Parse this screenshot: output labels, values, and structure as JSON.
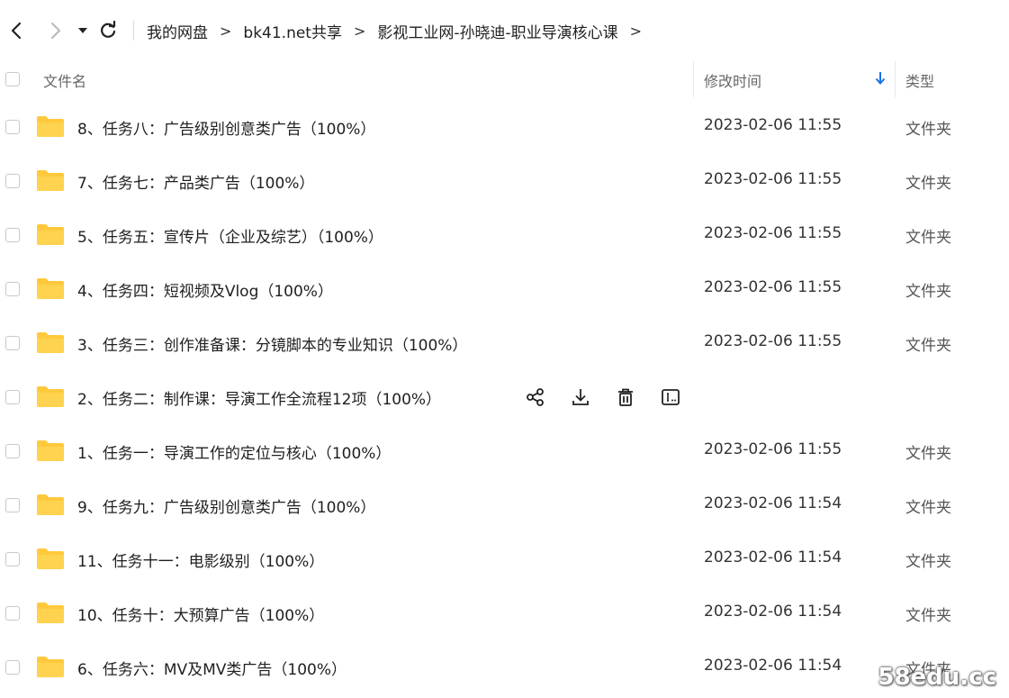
{
  "breadcrumb": [
    {
      "label": "我的网盘"
    },
    {
      "label": "bk41.net共享"
    },
    {
      "label": "影视工业网-孙晓迪-职业导演核心课"
    }
  ],
  "breadcrumb_trailing_sep": ">",
  "separator": ">",
  "columns": {
    "name": "文件名",
    "modified": "修改时间",
    "type": "类型"
  },
  "rows": [
    {
      "name": "8、任务八：广告级别创意类广告（100%）",
      "time": "2023-02-06 11:55",
      "type": "文件夹"
    },
    {
      "name": "7、任务七：产品类广告（100%）",
      "time": "2023-02-06 11:55",
      "type": "文件夹"
    },
    {
      "name": "5、任务五：宣传片（企业及综艺）（100%）",
      "time": "2023-02-06 11:55",
      "type": "文件夹"
    },
    {
      "name": "4、任务四：短视频及Vlog（100%）",
      "time": "2023-02-06 11:55",
      "type": "文件夹"
    },
    {
      "name": "3、任务三：创作准备课：分镜脚本的专业知识（100%）",
      "time": "2023-02-06 11:55",
      "type": "文件夹"
    },
    {
      "name": "2、任务二：制作课：导演工作全流程12项（100%）",
      "time": "",
      "type": "",
      "hovered": true
    },
    {
      "name": "1、任务一：导演工作的定位与核心（100%）",
      "time": "2023-02-06 11:55",
      "type": "文件夹"
    },
    {
      "name": "9、任务九：广告级别创意类广告（100%）",
      "time": "2023-02-06 11:54",
      "type": "文件夹"
    },
    {
      "name": "11、任务十一：电影级别（100%）",
      "time": "2023-02-06 11:54",
      "type": "文件夹"
    },
    {
      "name": "10、任务十：大预算广告（100%）",
      "time": "2023-02-06 11:54",
      "type": "文件夹"
    },
    {
      "name": "6、任务六：MV及MV类广告（100%）",
      "time": "2023-02-06 11:54",
      "type": "文件夹"
    }
  ],
  "hover_actions": [
    "share-icon",
    "download-icon",
    "delete-icon",
    "rename-icon"
  ],
  "folder_color": "#FFC93C",
  "sort_arrow_color": "#1a73e8",
  "watermark": "58edu.cc"
}
